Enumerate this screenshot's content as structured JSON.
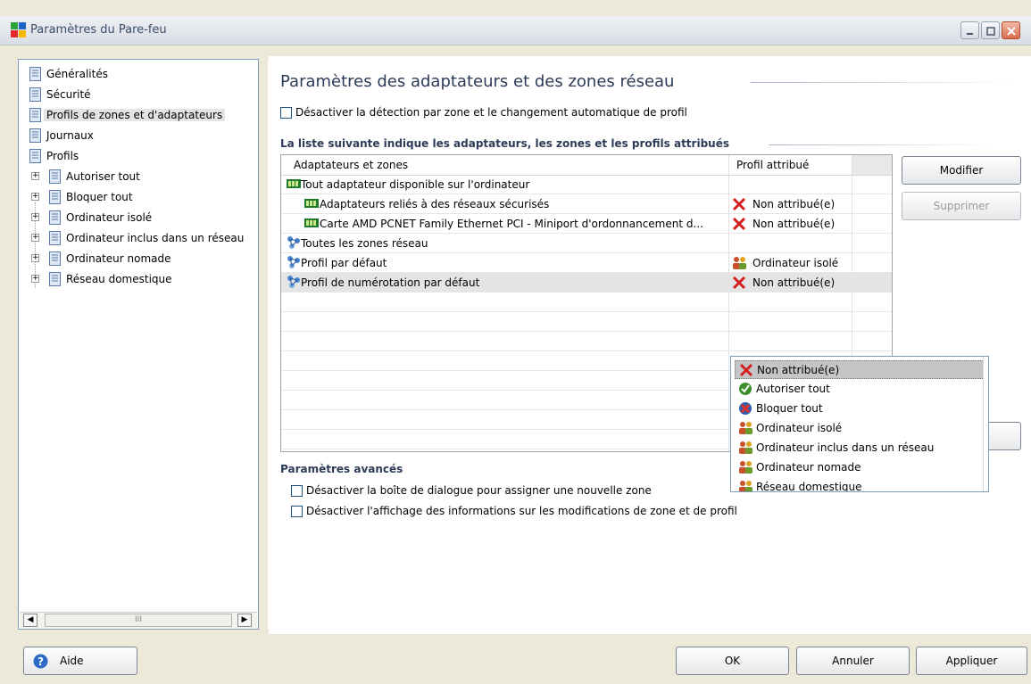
{
  "window": {
    "title": "Paramètres du Pare-feu"
  },
  "tree": {
    "items": [
      {
        "label": "Généralités"
      },
      {
        "label": "Sécurité"
      },
      {
        "label": "Profils de zones et d'adaptateurs"
      },
      {
        "label": "Journaux"
      },
      {
        "label": "Profils"
      },
      {
        "label": "Autoriser tout"
      },
      {
        "label": "Bloquer tout"
      },
      {
        "label": "Ordinateur isolé"
      },
      {
        "label": "Ordinateur inclus dans un réseau"
      },
      {
        "label": "Ordinateur nomade"
      },
      {
        "label": "Réseau domestique"
      }
    ],
    "scrollbar_grip": "III"
  },
  "main": {
    "heading": "Paramètres des adaptateurs et des zones réseau",
    "disable_zone_detection": "Désactiver la détection par zone et le changement automatique de profil",
    "list_heading": "La liste suivante indique les adaptateurs, les zones et les profils attribués",
    "columns": [
      "Adaptateurs et zones",
      "Profil attribué"
    ],
    "rows": [
      {
        "label": "Tout adaptateur disponible sur l'ordinateur",
        "profile": ""
      },
      {
        "label": "Adaptateurs reliés à des réseaux sécurisés",
        "profile": "Non attribué(e)"
      },
      {
        "label": "Carte AMD PCNET Family Ethernet PCI - Miniport d'ordonnancement d...",
        "profile": "Non attribué(e)"
      },
      {
        "label": "Toutes les zones réseau",
        "profile": ""
      },
      {
        "label": "Profil par défaut",
        "profile": "Ordinateur isolé"
      },
      {
        "label": "Profil de numérotation par défaut",
        "profile": "Non attribué(e)"
      }
    ],
    "buttons": {
      "modify": "Modifier",
      "delete": "Supprimer"
    },
    "dropdown_options": [
      "Non attribué(e)",
      "Autoriser tout",
      "Bloquer tout",
      "Ordinateur isolé",
      "Ordinateur inclus dans un réseau",
      "Ordinateur nomade",
      "Réseau domestique"
    ],
    "advanced_heading": "Paramètres avancés",
    "advanced_options": [
      "Désactiver la boîte de dialogue pour assigner une nouvelle zone",
      "Désactiver l'affichage des informations sur les modifications de zone et de profil"
    ]
  },
  "footer": {
    "help": "Aide",
    "ok": "OK",
    "cancel": "Annuler",
    "apply": "Appliquer"
  },
  "colors": {
    "accent": "#2c3b57",
    "selection": "#e4e4e4",
    "error_red": "#d21f1f"
  }
}
